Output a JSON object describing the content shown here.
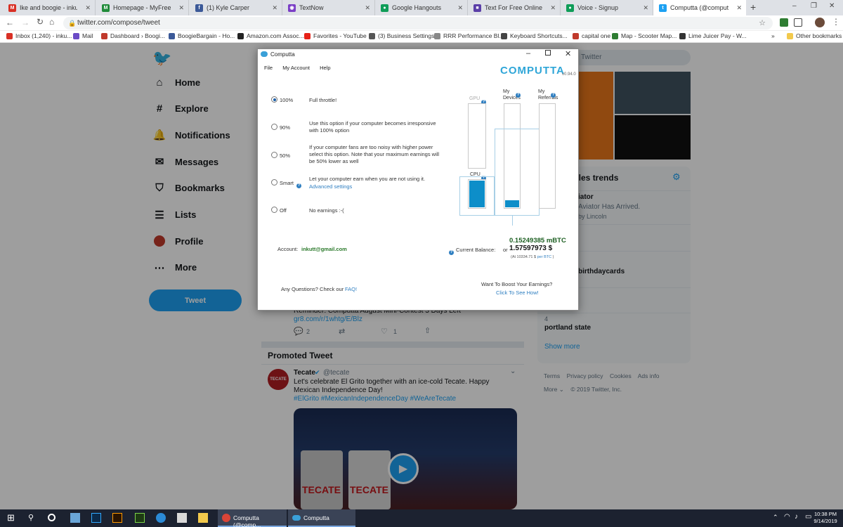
{
  "browser": {
    "tabs": [
      {
        "title": "Ike and boogie - inkutt@gn",
        "color": "#d93025",
        "glyph": "M"
      },
      {
        "title": "Homepage - MyFreeCams",
        "color": "#208b3a",
        "glyph": "M"
      },
      {
        "title": "(1) Kyle Carper",
        "color": "#3b5998",
        "glyph": "f"
      },
      {
        "title": "TextNow",
        "color": "#7b3fc6",
        "glyph": "◉"
      },
      {
        "title": "Google Hangouts",
        "color": "#0f9d58",
        "glyph": "●"
      },
      {
        "title": "Text For Free Online | TextFr",
        "color": "#5b3fa8",
        "glyph": "■"
      },
      {
        "title": "Voice - Signup",
        "color": "#0f9d58",
        "glyph": "●"
      },
      {
        "title": "Computta (@computtacom",
        "color": "#1da1f2",
        "glyph": "t"
      }
    ],
    "new_tab_label": "+",
    "url": "twitter.com/compose/tweet",
    "bookmarks": [
      {
        "label": "Inbox (1,240) - inku...",
        "color": "#d93025"
      },
      {
        "label": "Mail",
        "color": "#6b4bc6"
      },
      {
        "label": "Dashboard › Boogi...",
        "color": "#c0392b"
      },
      {
        "label": "BoogieBargain - Ho...",
        "color": "#3b5998"
      },
      {
        "label": "Amazon.com Assoc...",
        "color": "#222"
      },
      {
        "label": "Favorites - YouTube",
        "color": "#e62117"
      },
      {
        "label": "(3) Business Settings",
        "color": "#555"
      },
      {
        "label": "RRR Performance Bl...",
        "color": "#888"
      },
      {
        "label": "Keyboard Shortcuts...",
        "color": "#444"
      },
      {
        "label": "capital one",
        "color": "#c0392b"
      },
      {
        "label": "Map - Scooter Map...",
        "color": "#2e7d32"
      },
      {
        "label": "Lime Juicer Pay - W...",
        "color": "#333"
      }
    ],
    "more_bookmarks": "»",
    "other_bookmarks": "Other bookmarks"
  },
  "twitter": {
    "nav": [
      {
        "label": "Home",
        "icon": "home-icon",
        "glyph": "⌂"
      },
      {
        "label": "Explore",
        "icon": "hashtag-icon",
        "glyph": "#"
      },
      {
        "label": "Notifications",
        "icon": "bell-icon",
        "glyph": "🔔"
      },
      {
        "label": "Messages",
        "icon": "mail-icon",
        "glyph": "✉"
      },
      {
        "label": "Bookmarks",
        "icon": "bookmark-icon",
        "glyph": "⛉"
      },
      {
        "label": "Lists",
        "icon": "list-icon",
        "glyph": "☰"
      },
      {
        "label": "Profile",
        "icon": "avatar-icon",
        "glyph": "●"
      },
      {
        "label": "More",
        "icon": "more-icon",
        "glyph": "⋯"
      }
    ],
    "tweet_button": "Tweet",
    "search_placeholder": "Twitter",
    "trend_heading": "eles trends",
    "trends": [
      {
        "title": "iator",
        "sub": "Aviator Has Arrived.",
        "extra": "by Lincoln"
      },
      {
        "title": "birthdaycards",
        "sub": "",
        "extra": ""
      },
      {
        "rank": "4",
        "title": "portland state",
        "sub": "",
        "extra": ""
      }
    ],
    "show_more": "Show more",
    "footer": [
      "Terms",
      "Privacy policy",
      "Cookies",
      "Ads info"
    ],
    "footer_more": "More ⌄",
    "copyright": "© 2019 Twitter, Inc.",
    "tweet_partial": "Reminder: Computta August Mini-Contest 3 Days Left",
    "tweet_link": "gr8.com/r/1whtg/E/Blz",
    "tweet_replies": "2",
    "tweet_likes": "1",
    "promoted_heading": "Promoted Tweet",
    "promo_name": "Tecate",
    "promo_handle": "@tecate",
    "promo_text": "Let's celebrate El Grito together with an ice-cold Tecate. Happy Mexican Independence Day!",
    "promo_tags": "#ElGrito #MexicanIndependenceDay #WeAreTecate",
    "tecate_logo": "TECATE"
  },
  "app": {
    "title": "Computta",
    "menu": [
      "File",
      "My Account",
      "Help"
    ],
    "brand": "COMPUTTA",
    "version": "v0.94.0",
    "options": [
      {
        "label": "100%",
        "desc": "Full throttle!",
        "selected": true
      },
      {
        "label": "90%",
        "desc": "Use this option if your computer becomes irresponsive with 100% option",
        "selected": false
      },
      {
        "label": "50%",
        "desc": "If your computer fans are too noisy with higher power select this option. Note that your maximum earnings will be 50% lower as well",
        "selected": false
      },
      {
        "label": "Smart",
        "desc": "Let your computer earn when you are not using it.",
        "selected": false
      },
      {
        "label": "Off",
        "desc": "No earnings :-(",
        "selected": false
      }
    ],
    "advanced_link": "Advanced settings",
    "gpu_label": "GPU",
    "cpu_label": "CPU",
    "devices_label": "My Devices",
    "referrals_label": "My Referrals",
    "cpu_level": 1.0,
    "devices_level": 0.07,
    "account_label": "Account:",
    "account_value": "inkutt@gmail.com",
    "balance_label": "Current Balance:",
    "balance_btc": "0.15249385 mBTC",
    "balance_or": "or",
    "balance_usd": "1.57597973 $",
    "rate_prefix": "(At 10334.71 $",
    "rate_link": "per BTC",
    "rate_suffix": ")",
    "faq_text": "Any Questions? Check our",
    "faq_link": "FAQ!",
    "boost_text": "Want To Boost Your Earnings?",
    "boost_link": "Click To See How!"
  },
  "taskbar": {
    "items": [
      "Computta (@comp...",
      "Computta"
    ],
    "time": "10:38 PM",
    "date": "9/14/2019"
  }
}
